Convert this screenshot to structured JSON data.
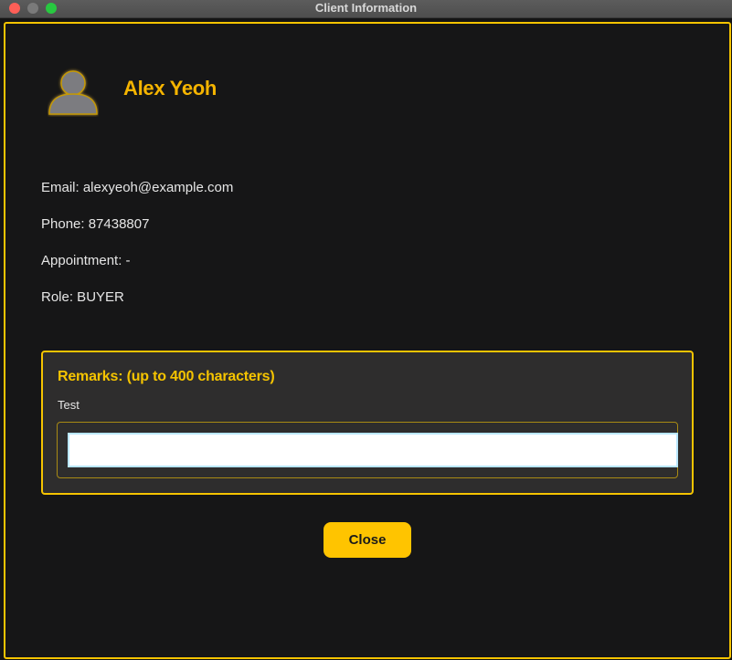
{
  "window": {
    "title": "Client Information"
  },
  "client": {
    "name": "Alex Yeoh",
    "email_line": "Email: alexyeoh@example.com",
    "phone_line": "Phone: 87438807",
    "appointment_line": "Appointment: -",
    "role_line": "Role: BUYER"
  },
  "remarks": {
    "title": "Remarks: (up to 400 characters)",
    "current_text": "Test",
    "input_value": ""
  },
  "actions": {
    "close_label": "Close"
  },
  "colors": {
    "accent": "#f5c400",
    "name": "#f5b400",
    "background": "#161617",
    "panel": "#2e2d2d"
  },
  "icons": {
    "avatar": "user-avatar-icon"
  }
}
